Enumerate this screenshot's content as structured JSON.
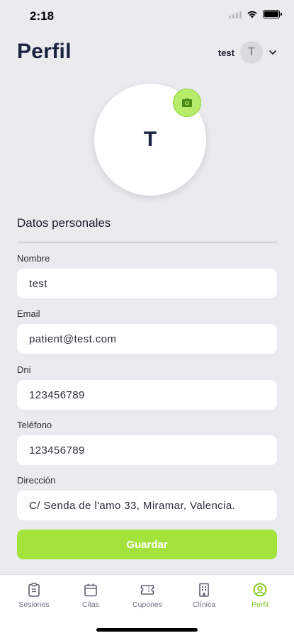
{
  "status_bar": {
    "time": "2:18"
  },
  "header": {
    "title": "Perfil",
    "user_name": "test",
    "user_initial": "T"
  },
  "profile": {
    "initial": "T"
  },
  "section": {
    "title": "Datos personales"
  },
  "form": {
    "nombre": {
      "label": "Nombre",
      "value": "test"
    },
    "email": {
      "label": "Email",
      "value": "patient@test.com"
    },
    "dni": {
      "label": "Dni",
      "value": "123456789"
    },
    "telefono": {
      "label": "Teléfono",
      "value": "123456789"
    },
    "direccion": {
      "label": "Dirección",
      "value": "C/ Senda de l'amo 33, Miramar, Valencia."
    }
  },
  "actions": {
    "save_label": "Guardar"
  },
  "tabs": [
    {
      "label": "Sesiones",
      "icon": "clipboard-icon",
      "active": false
    },
    {
      "label": "Citas",
      "icon": "calendar-icon",
      "active": false
    },
    {
      "label": "Cupones",
      "icon": "ticket-icon",
      "active": false
    },
    {
      "label": "Clínica",
      "icon": "building-icon",
      "active": false
    },
    {
      "label": "Perfil",
      "icon": "user-circle-icon",
      "active": true
    }
  ],
  "colors": {
    "accent": "#a4e23c",
    "active_tab": "#7bc41f",
    "background": "#e9ebee",
    "title": "#1a2340"
  }
}
